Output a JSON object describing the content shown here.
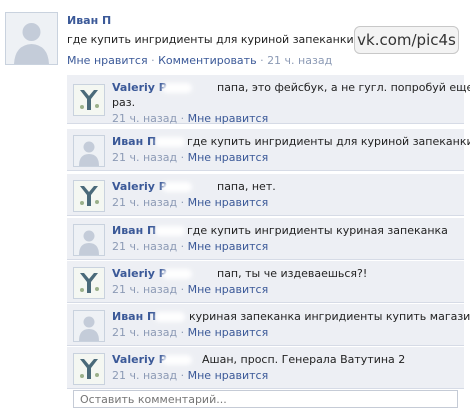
{
  "post": {
    "author": "Иван П",
    "text": "где купить ингридиенты для куриной запеканки киев",
    "like_label": "Мне нравится",
    "separator": "·",
    "comment_label": "Комментировать",
    "time": "21 ч. назад",
    "avatar_icon": "default-user-silhouette-icon"
  },
  "watermark": "vk.com/pic4s",
  "comments": [
    {
      "author": "Valeriy P",
      "avatar_icon": "y-logo-icon",
      "line1": "папа, это фейсбук, а не гугл. попробуй еще",
      "line2": "раз.",
      "time": "21 ч. назад",
      "like_label": "Мне нравится"
    },
    {
      "author": "Иван П",
      "avatar_icon": "default-user-silhouette-icon",
      "line1": "где купить ингридиенты для куриной запеканки",
      "line2": "",
      "time": "21 ч. назад",
      "like_label": "Мне нравится"
    },
    {
      "author": "Valeriy P",
      "avatar_icon": "y-logo-icon",
      "line1": "папа, нет.",
      "line2": "",
      "time": "21 ч. назад",
      "like_label": "Мне нравится"
    },
    {
      "author": "Иван П",
      "avatar_icon": "default-user-silhouette-icon",
      "line1": "где купить ингридиенты куриная запеканка",
      "line2": "",
      "time": "21 ч. назад",
      "like_label": "Мне нравится"
    },
    {
      "author": "Valeriy P",
      "avatar_icon": "y-logo-icon",
      "line1": "пап, ты че издеваешься?!",
      "line2": "",
      "time": "21 ч. назад",
      "like_label": "Мне нравится"
    },
    {
      "author": "Иван П",
      "avatar_icon": "default-user-silhouette-icon",
      "line1": "куриная запеканка ингридиенты купить магазин",
      "line2": "",
      "time": "21 ч. назад",
      "like_label": "Мне нравится"
    },
    {
      "author": "Valeriy P",
      "avatar_icon": "y-logo-icon",
      "line1": "Ашан, просп. Генерала Ватутина 2",
      "line2": "",
      "time": "21 ч. назад",
      "like_label": "Мне нравится"
    }
  ],
  "comment_input": {
    "placeholder": "Оставить комментарий..."
  },
  "colors": {
    "link": "#3b5998",
    "muted": "#8c9ab5",
    "comment_bg": "#edeff4"
  }
}
